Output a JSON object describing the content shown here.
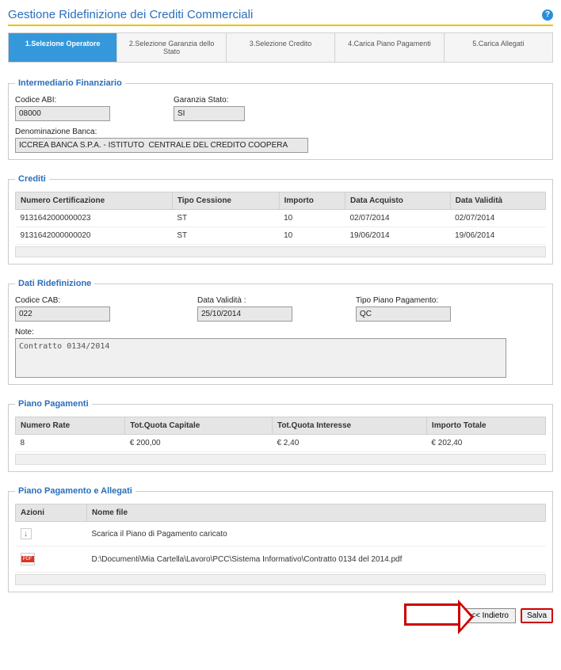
{
  "header": {
    "title": "Gestione Ridefinizione dei Crediti Commerciali"
  },
  "steps": [
    "1.Selezione Operatore",
    "2.Selezione Garanzia dello Stato",
    "3.Selezione Credito",
    "4.Carica Piano Pagamenti",
    "5.Carica Allegati"
  ],
  "intermediario": {
    "legend": "Intermediario Finanziario",
    "codice_abi_label": "Codice ABI:",
    "codice_abi": "08000",
    "garanzia_label": "Garanzia Stato:",
    "garanzia": "SI",
    "denom_label": "Denominazione Banca:",
    "denom": "ICCREA BANCA S.P.A. - ISTITUTO  CENTRALE DEL CREDITO COOPERA"
  },
  "crediti": {
    "legend": "Crediti",
    "headers": [
      "Numero Certificazione",
      "Tipo Cessione",
      "Importo",
      "Data Acquisto",
      "Data Validità"
    ],
    "rows": [
      [
        "9131642000000023",
        "ST",
        "10",
        "02/07/2014",
        "02/07/2014"
      ],
      [
        "9131642000000020",
        "ST",
        "10",
        "19/06/2014",
        "19/06/2014"
      ]
    ]
  },
  "ridef": {
    "legend": "Dati Ridefinizione",
    "cab_label": "Codice CAB:",
    "cab": "022",
    "data_label": "Data Validità :",
    "data": "25/10/2014",
    "tipo_label": "Tipo Piano Pagamento:",
    "tipo": "QC",
    "note_label": "Note:",
    "note": "Contratto 0134/2014"
  },
  "pagamenti": {
    "legend": "Piano Pagamenti",
    "headers": [
      "Numero Rate",
      "Tot.Quota Capitale",
      "Tot.Quota Interesse",
      "Importo Totale"
    ],
    "row": [
      "8",
      "€ 200,00",
      "€ 2,40",
      "€ 202,40"
    ]
  },
  "allegati": {
    "legend": "Piano Pagamento e Allegati",
    "headers": [
      "Azioni",
      "Nome file"
    ],
    "rows": [
      {
        "icon": "download",
        "text": "Scarica il Piano di Pagamento caricato"
      },
      {
        "icon": "pdf",
        "text": "D:\\Documenti\\Mia Cartella\\Lavoro\\PCC\\Sistema Informativo\\Contratto 0134 del 2014.pdf"
      }
    ]
  },
  "buttons": {
    "back": "<< Indietro",
    "save": "Salva"
  }
}
